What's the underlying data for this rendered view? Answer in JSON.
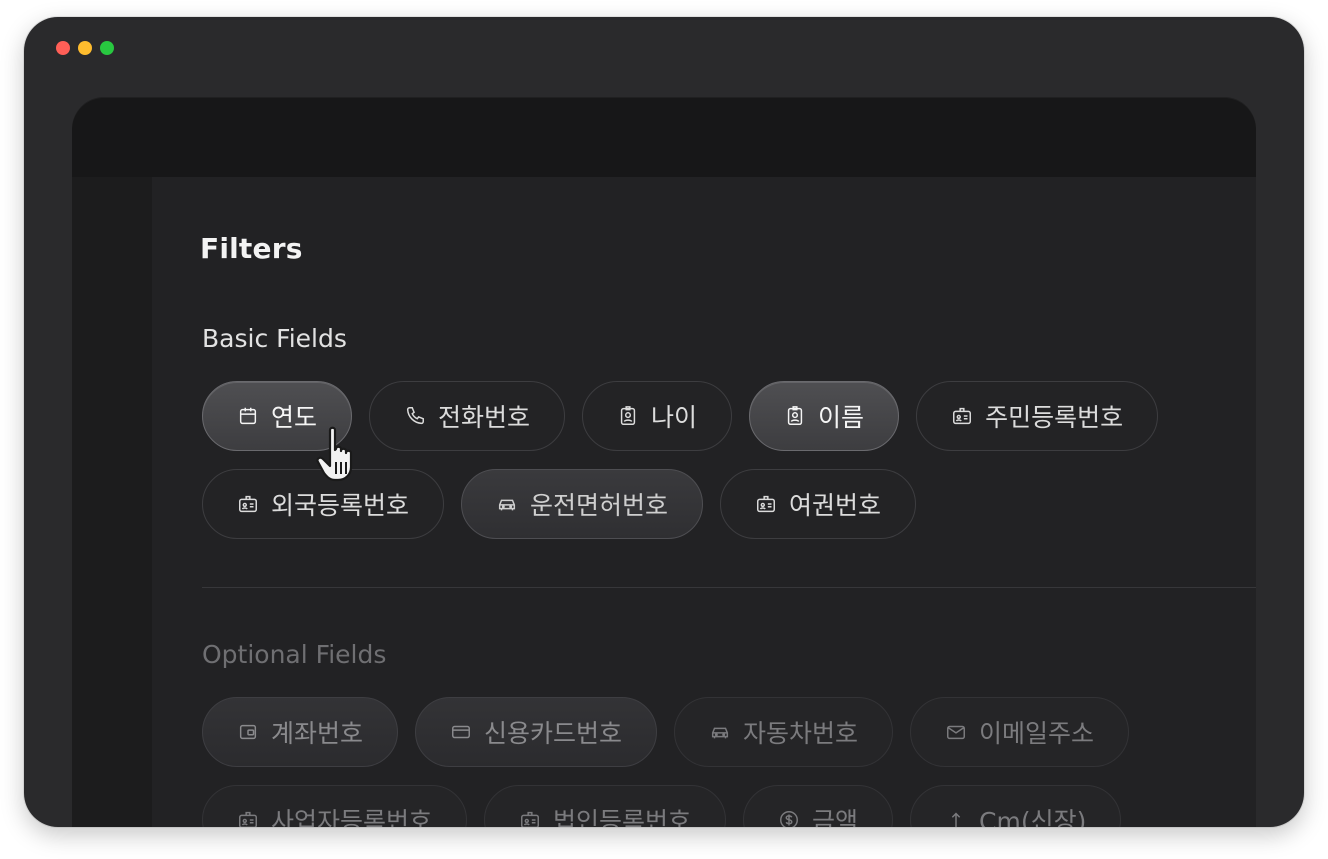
{
  "panel": {
    "title": "Filters"
  },
  "basic": {
    "title": "Basic Fields",
    "chips": [
      {
        "label": "연도",
        "icon": "calendar-icon",
        "state": "active"
      },
      {
        "label": "전화번호",
        "icon": "phone-icon",
        "state": "normal"
      },
      {
        "label": "나이",
        "icon": "id-badge-icon",
        "state": "normal"
      },
      {
        "label": "이름",
        "icon": "id-badge-icon",
        "state": "active"
      },
      {
        "label": "주민등록번호",
        "icon": "id-card-icon",
        "state": "normal"
      },
      {
        "label": "외국등록번호",
        "icon": "id-card-icon",
        "state": "normal"
      },
      {
        "label": "운전면허번호",
        "icon": "car-icon",
        "state": "soft"
      },
      {
        "label": "여권번호",
        "icon": "id-card-icon",
        "state": "normal"
      }
    ]
  },
  "optional": {
    "title": "Optional Fields",
    "chips": [
      {
        "label": "계좌번호",
        "icon": "wallet-icon",
        "state": "soft"
      },
      {
        "label": "신용카드번호",
        "icon": "credit-card-icon",
        "state": "soft"
      },
      {
        "label": "자동차번호",
        "icon": "car-icon",
        "state": "normal"
      },
      {
        "label": "이메일주소",
        "icon": "mail-icon",
        "state": "normal"
      },
      {
        "label": "사업자등록번호",
        "icon": "id-card-icon",
        "state": "normal"
      },
      {
        "label": "법인등록번호",
        "icon": "id-card-icon",
        "state": "normal"
      },
      {
        "label": "금액",
        "icon": "dollar-icon",
        "state": "normal"
      },
      {
        "label": "Cm(신장)",
        "icon": "arrow-up-icon",
        "state": "normal"
      }
    ]
  },
  "colors": {
    "window_bg": "#2a2a2c",
    "panel_bg": "#222224",
    "chip_active_bg": "#4a4a4d"
  }
}
